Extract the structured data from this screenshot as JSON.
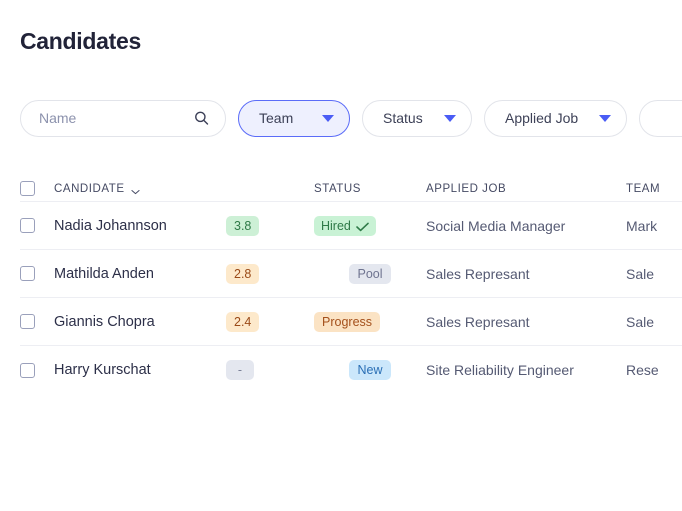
{
  "header": {
    "title": "Candidates"
  },
  "search": {
    "placeholder": "Name",
    "value": "",
    "icon": "search-icon"
  },
  "filters": [
    {
      "label": "Team",
      "active": true,
      "icon": "chevron-down-icon"
    },
    {
      "label": "Status",
      "active": false,
      "icon": "chevron-down-icon"
    },
    {
      "label": "Applied Job",
      "active": false,
      "icon": "chevron-down-icon"
    },
    {
      "label": "",
      "active": false,
      "icon": "chevron-down-icon"
    }
  ],
  "table": {
    "columns": {
      "candidate": "CANDIDATE",
      "score": "",
      "status": "STATUS",
      "applied_job": "APPLIED JOB",
      "team": "TEAM"
    },
    "sort_icon": "chevron-down-icon",
    "select_all_checkbox": false,
    "rows": [
      {
        "selected": false,
        "name": "Nadia Johannson",
        "score": "3.8",
        "score_tone": "green",
        "status": "Hired",
        "status_tone": "hired",
        "status_icon": "check-icon",
        "applied_job": "Social Media Manager",
        "team": "Mark"
      },
      {
        "selected": false,
        "name": "Mathilda Anden",
        "score": "2.8",
        "score_tone": "orange",
        "status": "Pool",
        "status_tone": "pool",
        "status_icon": "",
        "applied_job": "Sales Represant",
        "team": "Sale"
      },
      {
        "selected": false,
        "name": "Giannis Chopra",
        "score": "2.4",
        "score_tone": "orange",
        "status": "Progress",
        "status_tone": "progress",
        "status_icon": "",
        "applied_job": "Sales Represant",
        "team": "Sale"
      },
      {
        "selected": false,
        "name": "Harry Kurschat",
        "score": "-",
        "score_tone": "gray",
        "status": "New",
        "status_tone": "new",
        "status_icon": "",
        "applied_job": "Site Reliability Engineer",
        "team": "Rese"
      }
    ]
  },
  "colors": {
    "accent": "#4a5cf5",
    "accent_soft_bg": "#eef0fe",
    "title": "#212338",
    "text": "#555a73",
    "border": "#e2e4ea",
    "row_divider": "#edeef3",
    "green_bg": "#cdf0d6",
    "green_text": "#2f7a48",
    "orange_bg": "#fde9cb",
    "orange_text": "#9a4a18",
    "gray_bg": "#e4e7ef",
    "gray_text": "#7b8198",
    "blue_bg": "#cbe7fb",
    "blue_text": "#2a6fb5"
  }
}
